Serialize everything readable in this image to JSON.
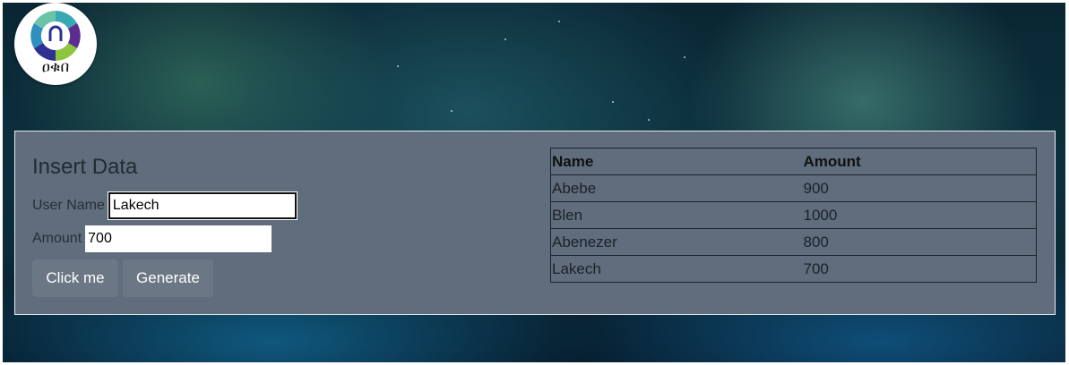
{
  "logo": {
    "text": "ዐቁበ",
    "colors": [
      "#2f8fc0",
      "#8cc63f",
      "#5b2d8e",
      "#36a9b4",
      "#6cc4a8",
      "#2e3192"
    ]
  },
  "form": {
    "title": "Insert Data",
    "username_label": "User Name",
    "username_value": "Lakech",
    "amount_label": "Amount",
    "amount_value": "700",
    "click_label": "Click me",
    "generate_label": "Generate"
  },
  "table": {
    "headers": [
      "Name",
      "Amount"
    ],
    "rows": [
      [
        "Abebe",
        "900"
      ],
      [
        "Blen",
        "1000"
      ],
      [
        "Abenezer",
        "800"
      ],
      [
        "Lakech",
        "700"
      ]
    ]
  },
  "colors": {
    "panel": "#5f6d7c",
    "button": "#6b7784"
  }
}
